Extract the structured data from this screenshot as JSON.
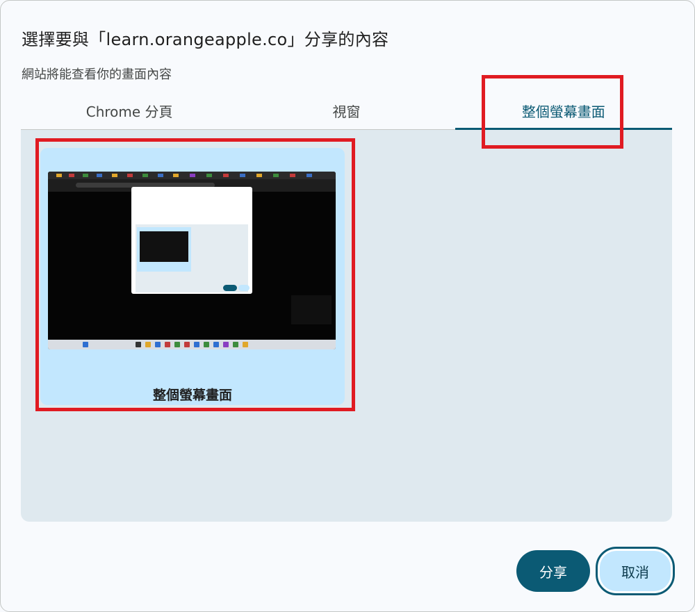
{
  "dialog": {
    "title": "選擇要與「learn.orangeapple.co」分享的內容",
    "subtitle": "網站將能查看你的畫面內容"
  },
  "tabs": [
    {
      "label": "Chrome 分頁",
      "active": false
    },
    {
      "label": "視窗",
      "active": false
    },
    {
      "label": "整個螢幕畫面",
      "active": true
    }
  ],
  "screen_card": {
    "label": "整個螢幕畫面",
    "thumbnail": "screen-preview"
  },
  "buttons": {
    "share_label": "分享",
    "cancel_label": "取消"
  },
  "colors": {
    "accent": "#0b5a74",
    "card_background": "#c2e7fe",
    "panel_background": "#dfe9ef",
    "annotation_highlight": "#e01b22"
  }
}
